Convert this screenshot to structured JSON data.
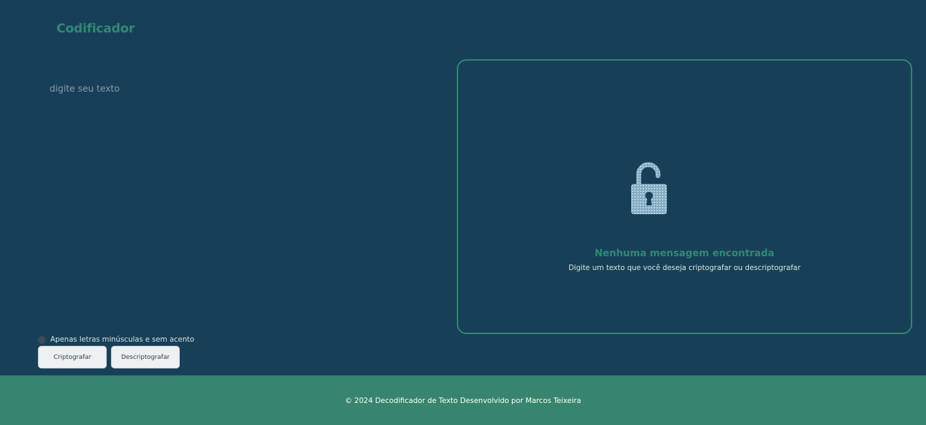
{
  "header": {
    "logo_text": "Codificador"
  },
  "input": {
    "placeholder": "digite seu texto",
    "value": ""
  },
  "output": {
    "title": "Nenhuma mensagem encontrada",
    "subtitle": "Digite um texto que você deseja criptografar ou descriptografar",
    "icon": "unlocked-padlock-icon"
  },
  "notice": {
    "icon": "info-dot-icon",
    "text": "Apenas letras minúsculas e sem acento"
  },
  "actions": {
    "encrypt_label": "Criptografar",
    "decrypt_label": "Descriptografar"
  },
  "footer": {
    "text": "© 2024 Decodificador de Texto Desenvolvido por Marcos Teixeira"
  },
  "colors": {
    "background": "#183f58",
    "accent": "#2f8a73",
    "footer_bg": "#37856f",
    "button_bg": "#eef0f2"
  }
}
